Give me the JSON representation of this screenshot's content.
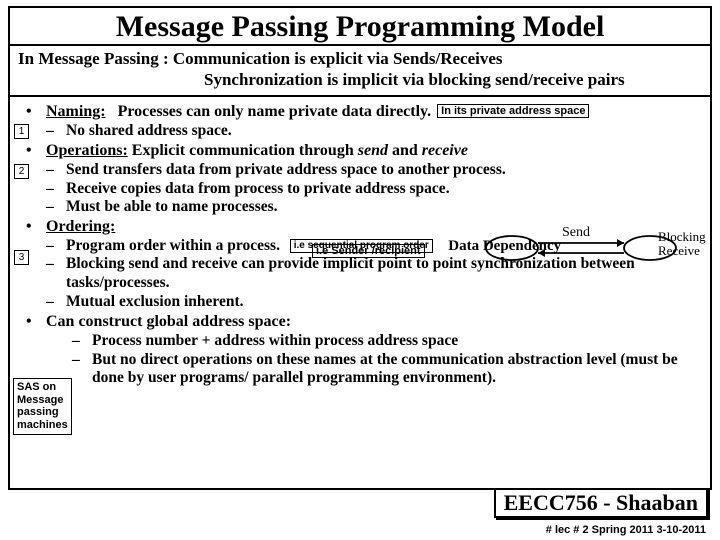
{
  "title": "Message Passing Programming Model",
  "intro": {
    "prefix": "In Message Passing :",
    "line1": "Communication is explicit via Sends/Receives",
    "line2": "Synchronization is implicit via blocking send/receive pairs"
  },
  "numbers": {
    "one": "1",
    "two": "2",
    "three": "3"
  },
  "naming": {
    "label": "Naming:",
    "text": "Processes can only name private data directly.",
    "tag": "In its private address space",
    "sub1": "No shared address space."
  },
  "operations": {
    "label": "Operations:",
    "text_a": "Explicit communication through ",
    "send": "send",
    "text_b": " and ",
    "receive": "receive",
    "sub1": "Send transfers data from private address space to another process.",
    "sub2": "Receive copies data from process to private address space.",
    "sub3": "Must be able to name processes.",
    "annot_sender": "i.e Sender /recipient",
    "send_label": "Send",
    "blocking_label": "Blocking\nReceive"
  },
  "ordering": {
    "label": "Ordering:",
    "sub1": "Program order within a process.",
    "annot_seq": "i.e sequential program order",
    "data_dep": "Data Dependency",
    "sub2": "Blocking send and receive can provide implicit point to point synchronization between tasks/processes.",
    "sub3": "Mutual exclusion inherent."
  },
  "construct": {
    "text": "Can construct global address space:",
    "sub1": "Process number + address within process address space",
    "sub2": "But no direct operations on these names at the communication abstraction level (must be done by user programs/ parallel programming environment)."
  },
  "sas_note": "SAS on\nMessage\npassing\nmachines",
  "footer": {
    "course": "EECC756 - Shaaban",
    "small": "#   lec # 2    Spring 2011   3-10-2011"
  }
}
